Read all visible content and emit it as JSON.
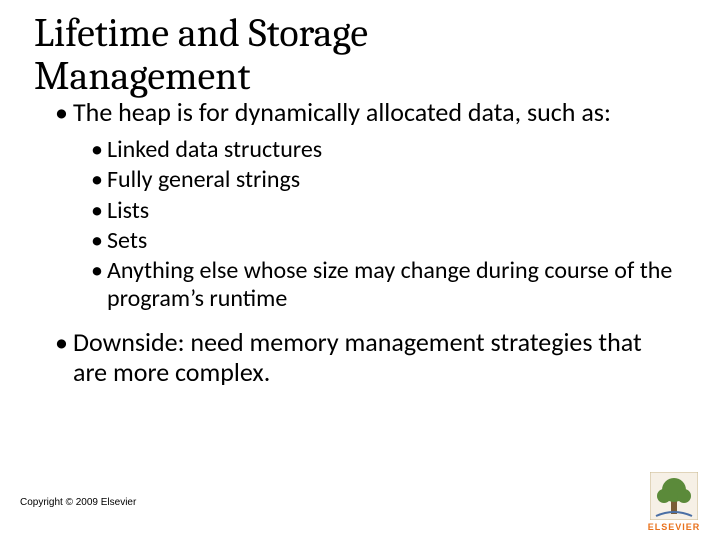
{
  "title_line1": "Lifetime and Storage",
  "title_line2": "Management",
  "bullets": {
    "b1": "The heap is for dynamically allocated data, such as:",
    "sub": {
      "s1": "Linked data structures",
      "s2": "Fully general strings",
      "s3": "Lists",
      "s4": "Sets",
      "s5": "Anything else whose size may change during course of the program’s runtime"
    },
    "b2": "Downside: need memory management strategies that are more complex."
  },
  "copyright": "Copyright © 2009 Elsevier",
  "logo_text": "ELSEVIER"
}
